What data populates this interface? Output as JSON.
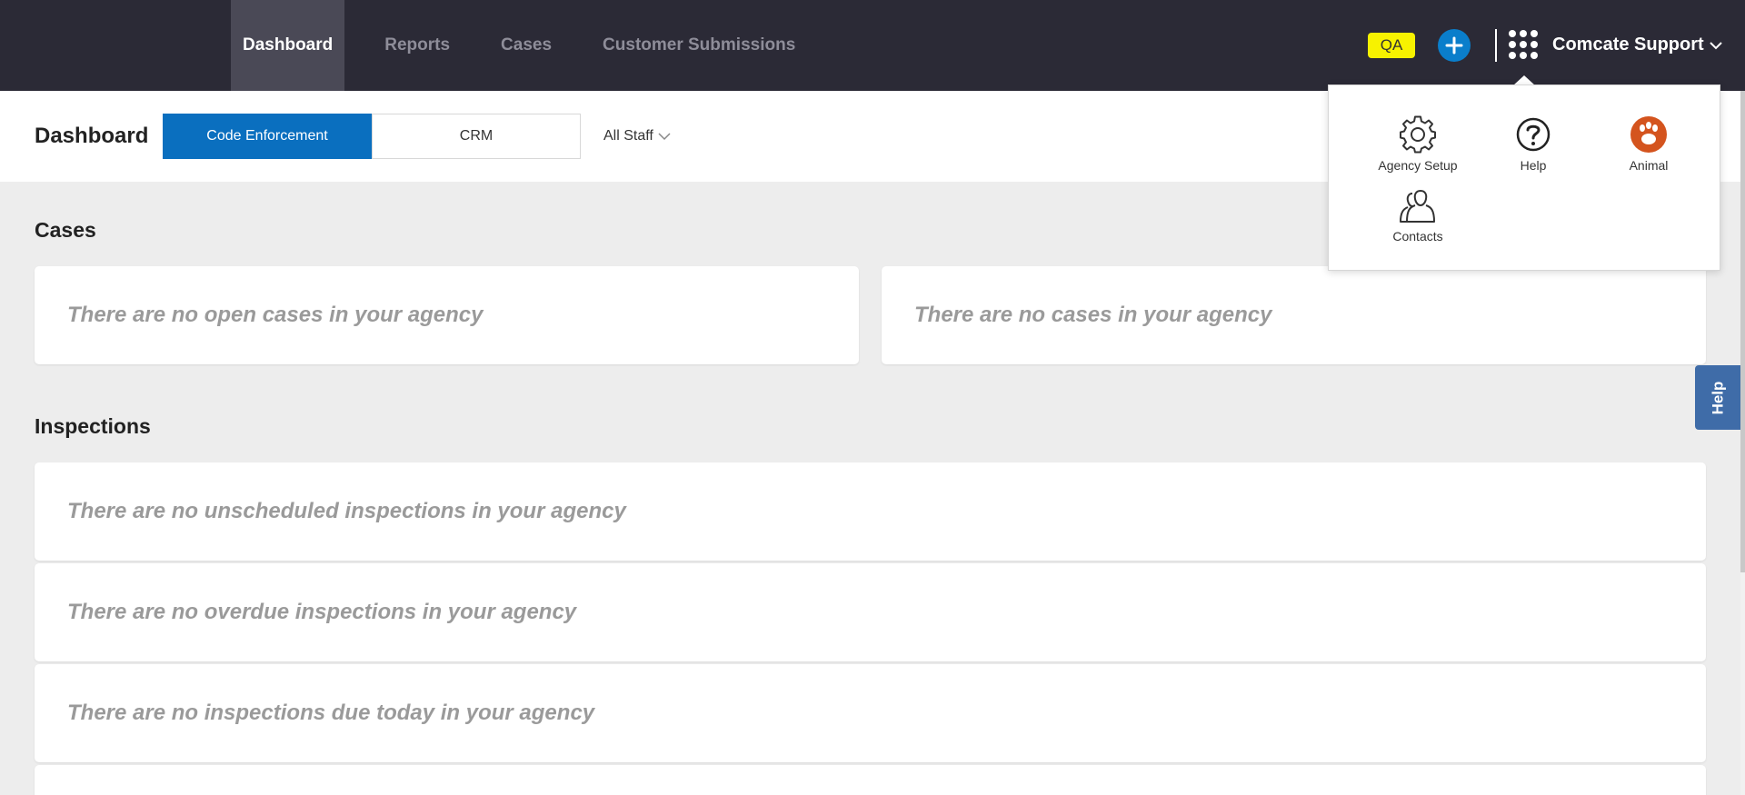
{
  "nav": {
    "items": [
      {
        "label": "Dashboard",
        "active": true
      },
      {
        "label": "Reports",
        "active": false
      },
      {
        "label": "Cases",
        "active": false
      },
      {
        "label": "Customer Submissions",
        "active": false
      }
    ]
  },
  "header": {
    "env_badge": "QA",
    "add_icon": "plus-icon",
    "apps_icon": "grid-icon",
    "account_name": "Comcate Support"
  },
  "subheader": {
    "title": "Dashboard",
    "segments": [
      {
        "label": "Code Enforcement",
        "selected": true
      },
      {
        "label": "CRM",
        "selected": false
      }
    ],
    "staff_filter": "All Staff"
  },
  "sections": {
    "cases": {
      "title": "Cases",
      "cards": [
        "There are no open cases in your agency",
        "There are no cases in your agency"
      ]
    },
    "inspections": {
      "title": "Inspections",
      "cards": [
        "There are no unscheduled inspections in your agency",
        "There are no overdue inspections in your agency",
        "There are no inspections due today in your agency"
      ]
    }
  },
  "apps_menu": {
    "items": [
      {
        "label": "Agency Setup",
        "icon": "gear-icon"
      },
      {
        "label": "Help",
        "icon": "question-circle-icon"
      },
      {
        "label": "Animal",
        "icon": "paw-icon"
      },
      {
        "label": "Contacts",
        "icon": "contacts-icon"
      }
    ]
  },
  "help_tab": "Help",
  "colors": {
    "topbar": "#2b2a36",
    "primary": "#0a6fbf",
    "qa_badge": "#f7f200",
    "animal_icon": "#d4541e",
    "help_tab": "#3f6ca8"
  }
}
